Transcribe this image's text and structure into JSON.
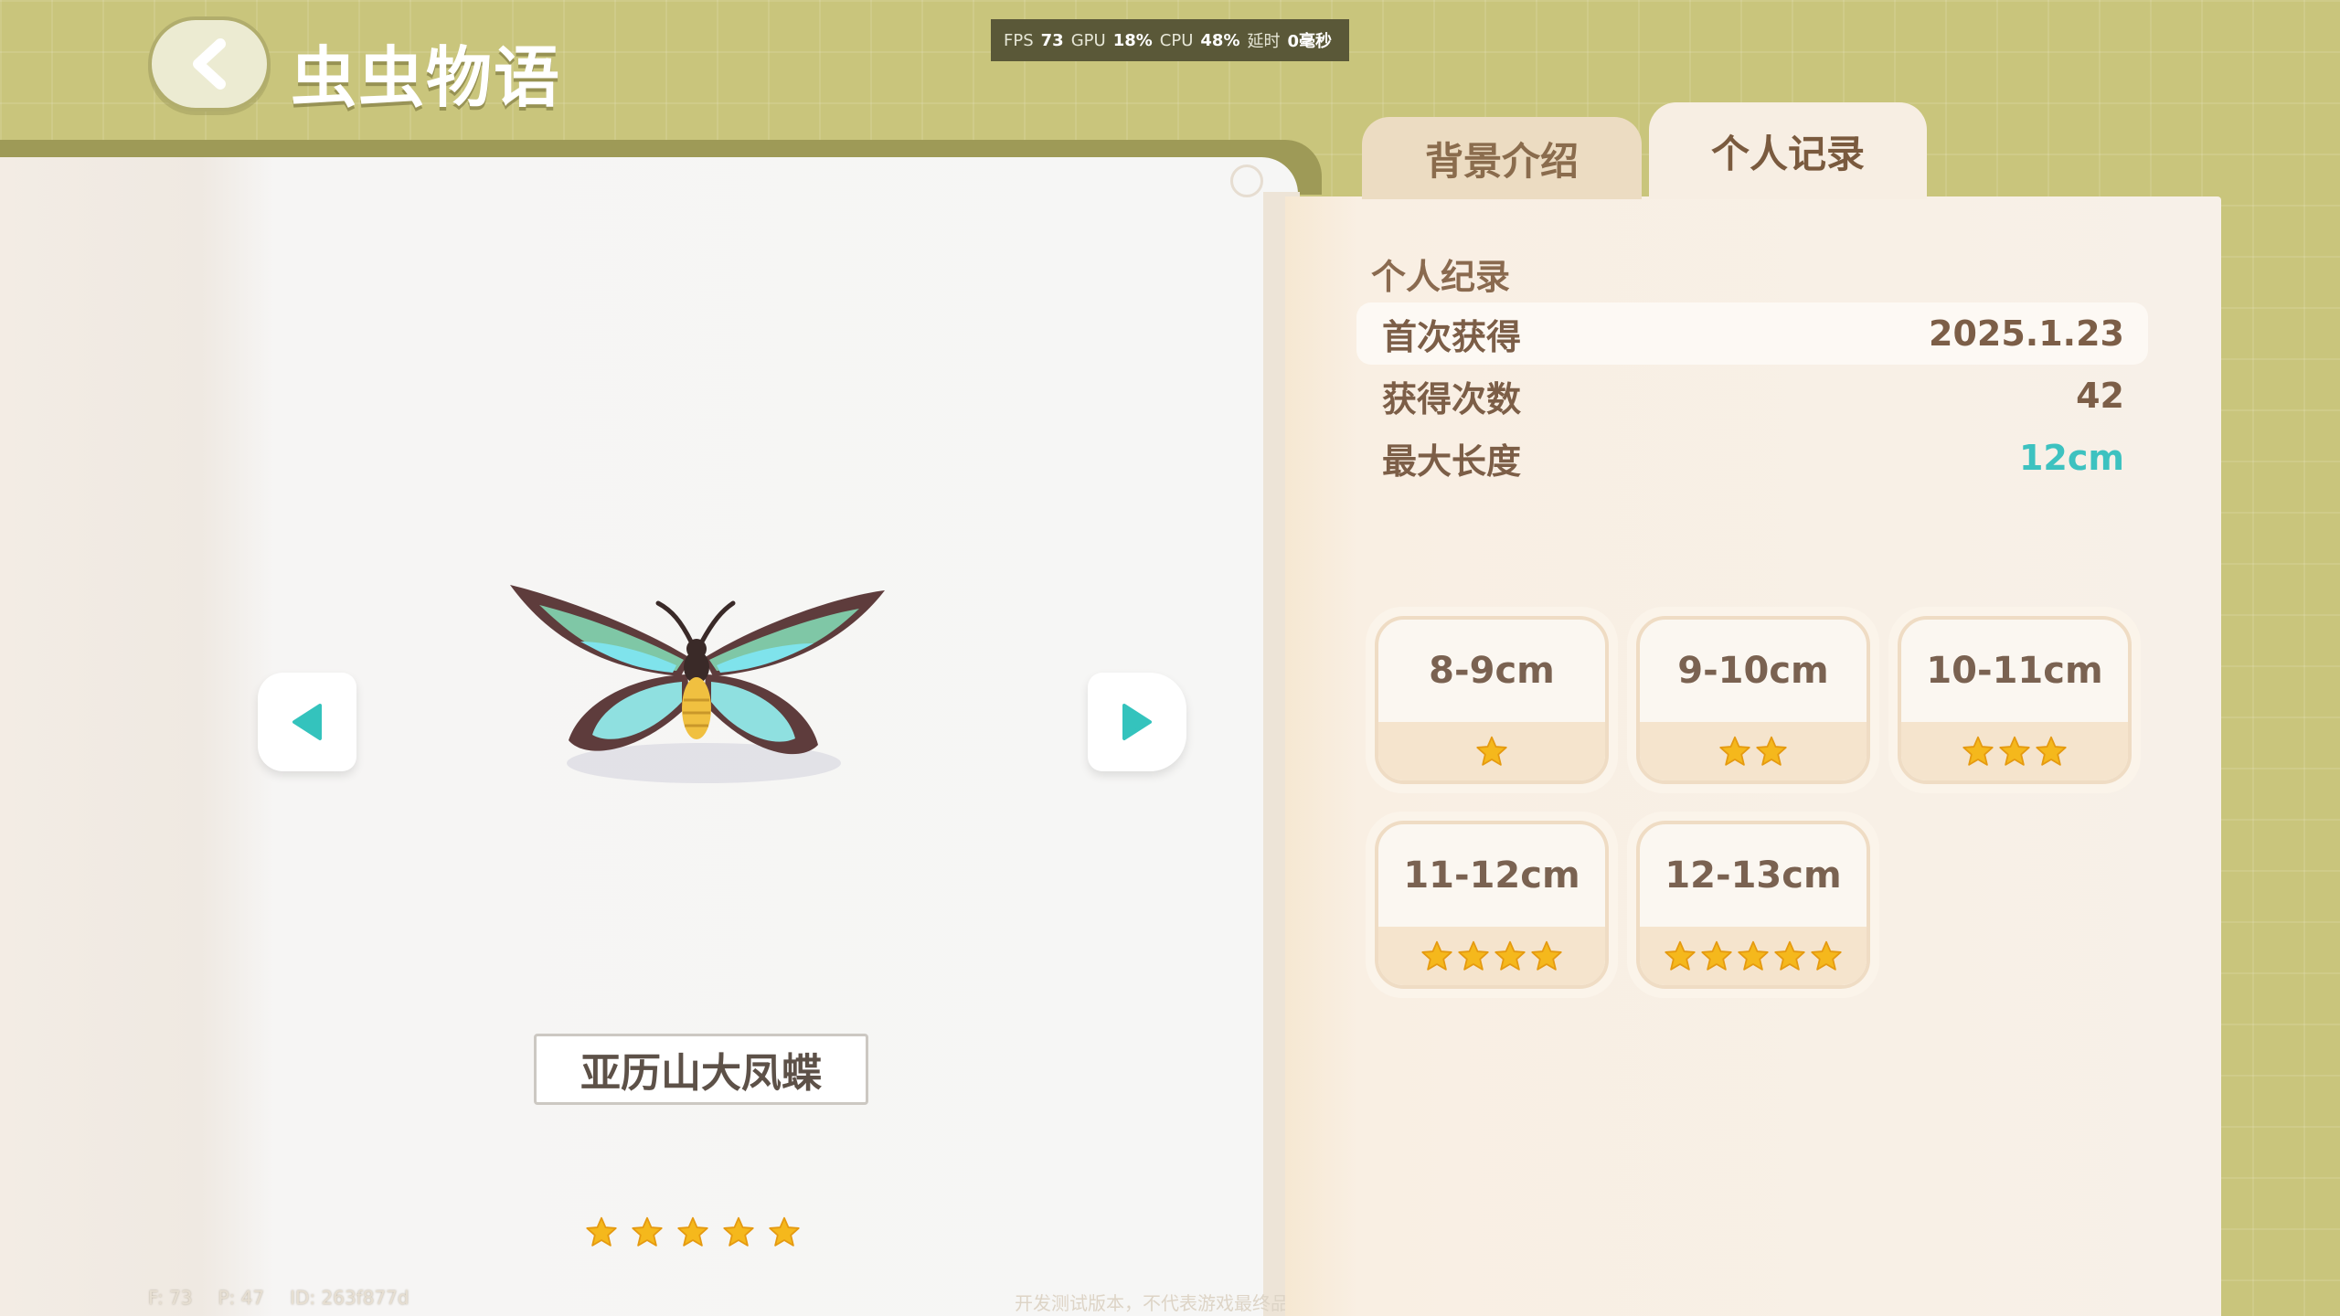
{
  "header": {
    "title": "虫虫物语",
    "back_icon": "chevron-left-icon"
  },
  "perf": {
    "fps_label": "FPS",
    "fps": "73",
    "gpu_label": "GPU",
    "gpu": "18%",
    "cpu_label": "CPU",
    "cpu": "48%",
    "latency_label": "延时",
    "latency": "0毫秒"
  },
  "insect": {
    "name": "亚历山大凤蝶",
    "rarity_stars": 5
  },
  "debug": {
    "f": "F: 73",
    "p": "P: 47",
    "id": "ID: 263f877d"
  },
  "footer_note": "开发测试版本，不代表游戏最终品质",
  "tabs": [
    {
      "label": "背景介绍",
      "active": false
    },
    {
      "label": "个人记录",
      "active": true
    }
  ],
  "record": {
    "heading": "个人纪录",
    "rows": [
      {
        "label": "首次获得",
        "value": "2025.1.23"
      },
      {
        "label": "获得次数",
        "value": "42"
      },
      {
        "label": "最大长度",
        "value": "12cm"
      }
    ]
  },
  "size_tiers": [
    {
      "range": "8-9cm",
      "stars": 1
    },
    {
      "range": "9-10cm",
      "stars": 2
    },
    {
      "range": "10-11cm",
      "stars": 3
    },
    {
      "range": "11-12cm",
      "stars": 4
    },
    {
      "range": "12-13cm",
      "stars": 5
    }
  ],
  "colors": {
    "accent_teal": "#3dc2c0",
    "star": "#f5b81c",
    "background": "#c9c57c"
  }
}
